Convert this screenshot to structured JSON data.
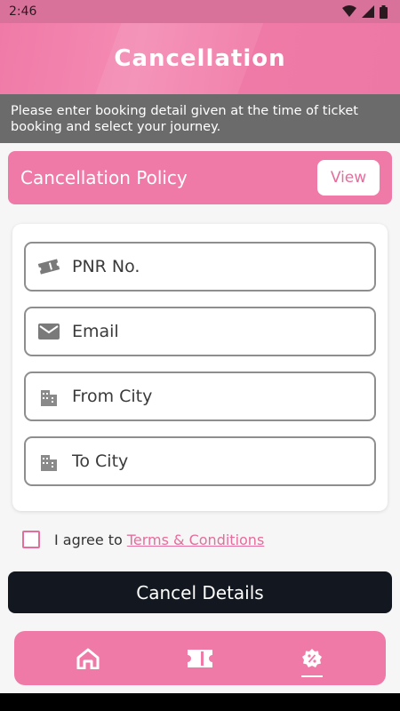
{
  "status_bar": {
    "time": "2:46"
  },
  "header": {
    "title": "Cancellation"
  },
  "info": {
    "text": "Please enter booking detail given at the time of ticket booking and select your journey."
  },
  "policy": {
    "title": "Cancellation Policy",
    "view_label": "View"
  },
  "form": {
    "pnr_placeholder": "PNR No.",
    "email_placeholder": "Email",
    "from_city_placeholder": "From City",
    "to_city_placeholder": "To City"
  },
  "agree": {
    "text": "I agree to",
    "link": "Terms & Conditions"
  },
  "cancel_button_label": "Cancel Details",
  "nav": {
    "items": [
      {
        "icon": "home-icon"
      },
      {
        "icon": "ticket-icon"
      },
      {
        "icon": "discount-icon",
        "active": true
      }
    ]
  },
  "colors": {
    "accent": "#f07aa7",
    "banner": "#6b6b6b",
    "button": "#131820"
  }
}
